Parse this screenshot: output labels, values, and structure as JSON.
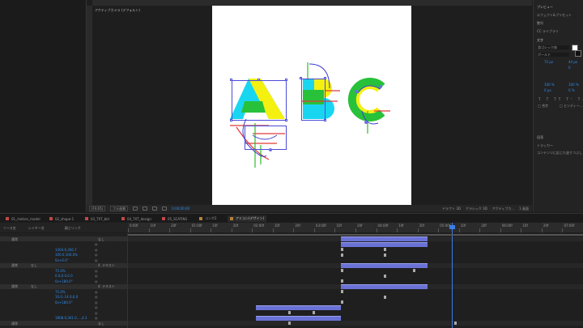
{
  "composition_panel": {
    "title": "アクティブカメラ (デフォルト)",
    "zoom_label": "(Fit.65)",
    "resolution_label": "フル画質",
    "timecode": "0;00;00;00",
    "bottom_right_labels": [
      "ドラフト 3D",
      "クラシック 3D",
      "アクティブカ...",
      "1 画面"
    ]
  },
  "right_panel": {
    "title": "プレビュー",
    "items": [
      "エフェクト&プリセット",
      "整列",
      "CC ライブラリ"
    ],
    "character_section": "文字",
    "font_name": "游ゴシック体",
    "font_style": "ボールド",
    "size_value": "72 px",
    "leading_value": "44 px",
    "tracking_value": "0",
    "vscale_value": "100 %",
    "hscale_value": "100 %",
    "baseline_value": "0 px",
    "tsume_value": "0 %",
    "checkbox1": "合字",
    "checkbox2": "ヒンディー...",
    "paragraph_section": "段落",
    "tracker_section": "トラッカー",
    "tracker_button": "コンテンツに応じた塗りつぶし"
  },
  "tabs": [
    {
      "label": "01_motion_model",
      "color": "#c24848"
    },
    {
      "label": "02_shape-1",
      "color": "#c24848"
    },
    {
      "label": "03_TXT_bld",
      "color": "#c24848"
    },
    {
      "label": "04_TXT_design",
      "color": "#c24848"
    },
    {
      "label": "05_SCATINS",
      "color": "#c24848"
    },
    {
      "label": "コンポ2",
      "color": "#b3833a"
    },
    {
      "label": "アミコン(デザイン)",
      "color": "#b3833a",
      "active": true
    }
  ],
  "timeline": {
    "header_left": [
      "ソース名",
      "レイヤー名",
      "モード",
      "T",
      "トラックマット",
      "親とリンク"
    ],
    "ruler_labels": [
      "0:00f",
      "10f",
      "20f",
      "01:00f",
      "10f",
      "20f",
      "02:00f",
      "10f",
      "20f",
      "03:00f",
      "10f",
      "20f",
      "04:00f",
      "10f",
      "20f",
      "05:00f",
      "10f",
      "20f",
      "06:00f",
      "10f",
      "20f",
      "07:00f"
    ],
    "rows": [
      {
        "text": "通常",
        "kind": "layer",
        "parent": "なし"
      },
      {
        "text": "",
        "kind": "prop"
      },
      {
        "text": "1404.6,360.7",
        "kind": "value"
      },
      {
        "text": "100.0,100.0%",
        "kind": "value"
      },
      {
        "text": "0x+0.0°",
        "kind": "value"
      },
      {
        "text": "通常",
        "kind": "layer",
        "mode2": "なし",
        "parent": "4. テキスト"
      },
      {
        "text": "75.0%",
        "kind": "value"
      },
      {
        "text": "0.0,0.0,0.0",
        "kind": "value"
      },
      {
        "text": "0x+180.0°",
        "kind": "value"
      },
      {
        "text": "通常",
        "kind": "layer",
        "mode2": "なし",
        "parent": "4. テキスト"
      },
      {
        "text": "75.0%",
        "kind": "value"
      },
      {
        "text": "10.0,-14.0,0.0",
        "kind": "value"
      },
      {
        "text": "0x+180.0°",
        "kind": "value"
      },
      {
        "text": "",
        "kind": "prop"
      },
      {
        "text": "",
        "kind": "prop"
      },
      {
        "text": "1808.0,361.0,...,4.3",
        "kind": "value"
      },
      {
        "text": "通常",
        "kind": "layer",
        "parent": "なし"
      }
    ],
    "bottom_label": "切り替え / モード"
  }
}
